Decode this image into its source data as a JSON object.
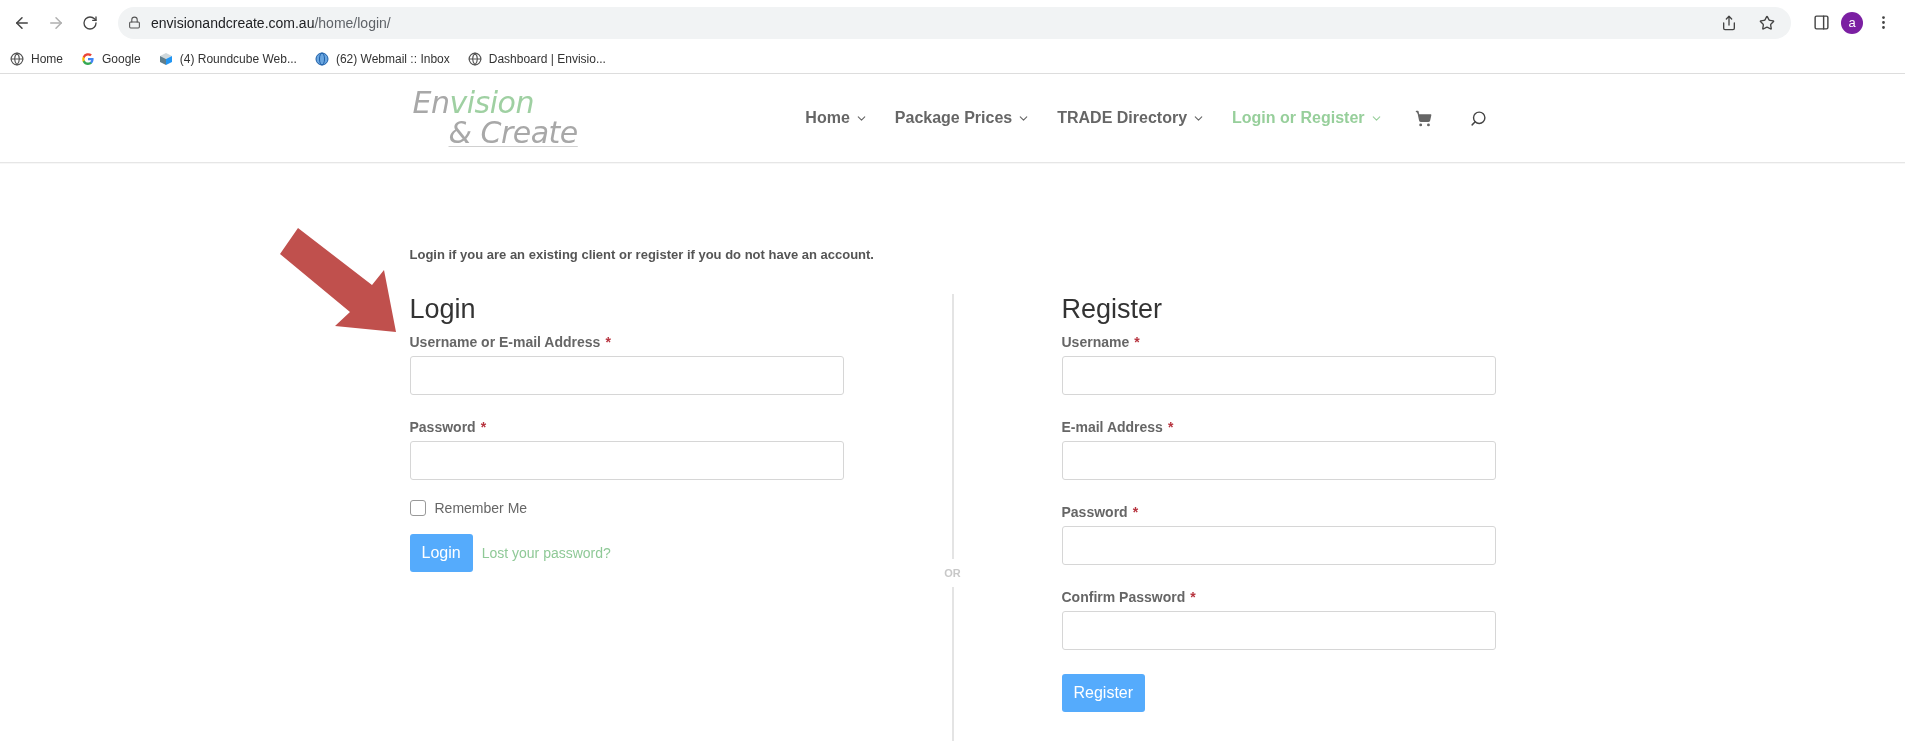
{
  "browser": {
    "url": {
      "host": "envisionandcreate.com.au",
      "path": "/home/login/"
    },
    "forward_disabled": true,
    "avatar": "a",
    "bookmarks": [
      {
        "kind": "globe",
        "label": "Home"
      },
      {
        "kind": "google",
        "label": "Google"
      },
      {
        "kind": "cube",
        "label": "(4) Roundcube Web..."
      },
      {
        "kind": "mail",
        "label": "(62) Webmail :: Inbox"
      },
      {
        "kind": "globe",
        "label": "Dashboard | Envisio..."
      }
    ]
  },
  "header": {
    "logo": {
      "line1": [
        {
          "text": "En",
          "color": "#a8a8a8"
        },
        {
          "text": "vision",
          "color": "#9fd0a2"
        }
      ],
      "line2": "& Create"
    },
    "nav": [
      {
        "label": "Home",
        "selected": false
      },
      {
        "label": "Package Prices",
        "selected": false
      },
      {
        "label": "TRADE Directory",
        "selected": false
      },
      {
        "label": "Login or Register",
        "selected": true
      }
    ]
  },
  "intro": "Login if you are an existing client or register if you do not have an account.",
  "login": {
    "title": "Login",
    "fields": [
      {
        "label": "Username or E-mail Address",
        "mark": "*"
      },
      {
        "label": "Password",
        "mark": "*"
      }
    ],
    "remember": {
      "label": "Remember Me",
      "checked": false
    },
    "button": "Login",
    "lost_link": "Lost your password?"
  },
  "separator": "OR",
  "register": {
    "title": "Register",
    "fields": [
      {
        "label": "Username",
        "mark": "*"
      },
      {
        "label": "E-mail Address",
        "mark": "*"
      },
      {
        "label": "Password",
        "mark": "*"
      },
      {
        "label": "Confirm Password",
        "mark": "*"
      }
    ],
    "button": "Register"
  }
}
